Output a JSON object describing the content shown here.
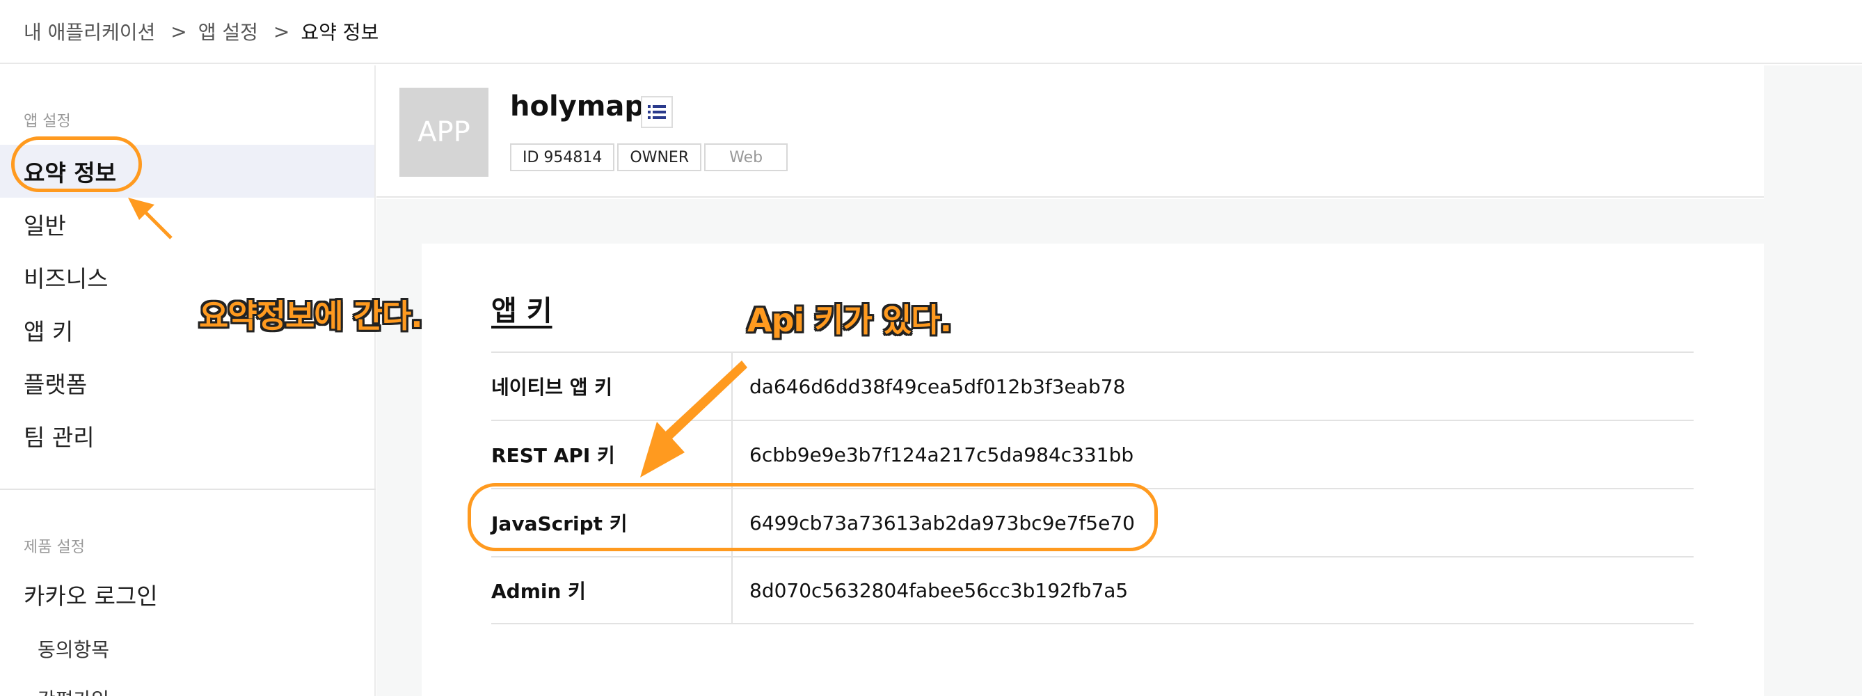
{
  "breadcrumb": {
    "item1": "내 애플리케이션",
    "item2": "앱 설정",
    "current": "요약 정보",
    "separator": ">"
  },
  "sidebar": {
    "group1_title": "앱 설정",
    "items": [
      {
        "label": "요약 정보",
        "active": true
      },
      {
        "label": "일반"
      },
      {
        "label": "비즈니스"
      },
      {
        "label": "앱 키"
      },
      {
        "label": "플랫폼"
      },
      {
        "label": "팀 관리"
      }
    ],
    "group2_title": "제품 설정",
    "group2_items": [
      {
        "label": "카카오 로그인"
      }
    ],
    "sub_items": [
      {
        "label": "동의항목"
      },
      {
        "label": "간편가입"
      }
    ]
  },
  "app": {
    "thumb_text": "APP",
    "name": "holymap",
    "tags": [
      "ID 954814",
      "OWNER",
      "Web"
    ]
  },
  "keys": {
    "title": "앱 키",
    "rows": [
      {
        "label": "네이티브 앱 키",
        "value": "da646d6dd38f49cea5df012b3f3eab78"
      },
      {
        "label": "REST API 키",
        "value": "6cbb9e9e3b7f124a217c5da984c331bb"
      },
      {
        "label": "JavaScript 키",
        "value": "6499cb73a73613ab2da973bc9e7f5e70"
      },
      {
        "label": "Admin 키",
        "value": "8d070c5632804fabee56cc3b192fb7a5"
      }
    ]
  },
  "annotations": {
    "left_note": "요약정보에 간다.",
    "right_note": "Api 키가 있다.",
    "color": "#ff9a1f"
  },
  "icons": {
    "list": "list-icon"
  }
}
